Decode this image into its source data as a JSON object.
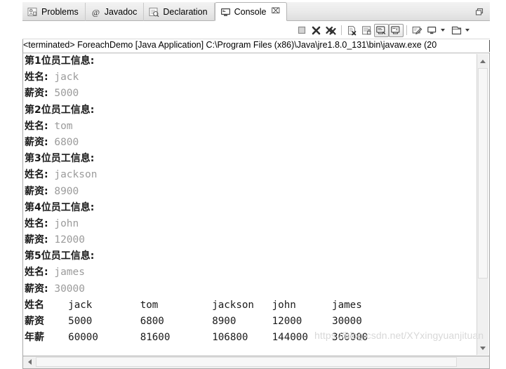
{
  "view": {
    "tabs": [
      {
        "label": "Problems",
        "icon": "problems-icon",
        "active": false
      },
      {
        "label": "Javadoc",
        "icon": "javadoc-at-icon",
        "active": false
      },
      {
        "label": "Declaration",
        "icon": "declaration-icon",
        "active": false
      },
      {
        "label": "Console",
        "icon": "console-monitor-icon",
        "active": true,
        "close_glyph": "⌧"
      }
    ],
    "maximize_icon": "restore-view-icon"
  },
  "toolbar": {
    "items": [
      {
        "name": "terminate-button",
        "icon": "stop-square-icon",
        "pressed": false
      },
      {
        "name": "remove-launch-button",
        "icon": "remove-x-icon",
        "pressed": false
      },
      {
        "name": "remove-all-terminated-button",
        "icon": "remove-all-xx-icon",
        "pressed": false
      },
      {
        "name": "clear-console-button",
        "icon": "clear-console-icon",
        "pressed": false
      },
      {
        "name": "scroll-lock-button",
        "icon": "scroll-lock-icon",
        "pressed": false
      },
      {
        "name": "show-console-when-stdout-button",
        "icon": "stdout-console-icon",
        "pressed": true
      },
      {
        "name": "show-console-when-stderr-button",
        "icon": "stderr-console-icon",
        "pressed": true
      },
      {
        "name": "pin-console-button",
        "icon": "pin-console-icon",
        "pressed": false
      },
      {
        "name": "display-selected-console-button",
        "icon": "display-console-icon",
        "pressed": false
      },
      {
        "name": "open-console-button",
        "icon": "open-console-icon",
        "pressed": false
      }
    ]
  },
  "process": {
    "line": "<terminated> ForeachDemo [Java Application] C:\\Program Files (x86)\\Java\\jre1.8.0_131\\bin\\javaw.exe (20"
  },
  "console": {
    "employees": [
      {
        "header": "第1位员工信息:",
        "name_label": "姓名:",
        "name": "jack",
        "salary_label": "薪资:",
        "salary": "5000"
      },
      {
        "header": "第2位员工信息:",
        "name_label": "姓名:",
        "name": "tom",
        "salary_label": "薪资:",
        "salary": "6800"
      },
      {
        "header": "第3位员工信息:",
        "name_label": "姓名:",
        "name": "jackson",
        "salary_label": "薪资:",
        "salary": "8900"
      },
      {
        "header": "第4位员工信息:",
        "name_label": "姓名:",
        "name": "john",
        "salary_label": "薪资:",
        "salary": "12000"
      },
      {
        "header": "第5位员工信息:",
        "name_label": "姓名:",
        "name": "james",
        "salary_label": "薪资:",
        "salary": "30000"
      }
    ],
    "table": {
      "rows": [
        {
          "label": "姓名",
          "cells": [
            "jack",
            "tom",
            "jackson",
            "john",
            "james"
          ]
        },
        {
          "label": "薪资",
          "cells": [
            "5000",
            "6800",
            "8900",
            "12000",
            "30000"
          ]
        },
        {
          "label": "年薪",
          "cells": [
            "60000",
            "81600",
            "106800",
            "144000",
            "360000"
          ]
        }
      ]
    },
    "value_color": "#9b9b9b",
    "text_color": "#1a1a1a"
  },
  "watermark": {
    "text": "https://blog.csdn.net/XYxingyuanjituan"
  }
}
